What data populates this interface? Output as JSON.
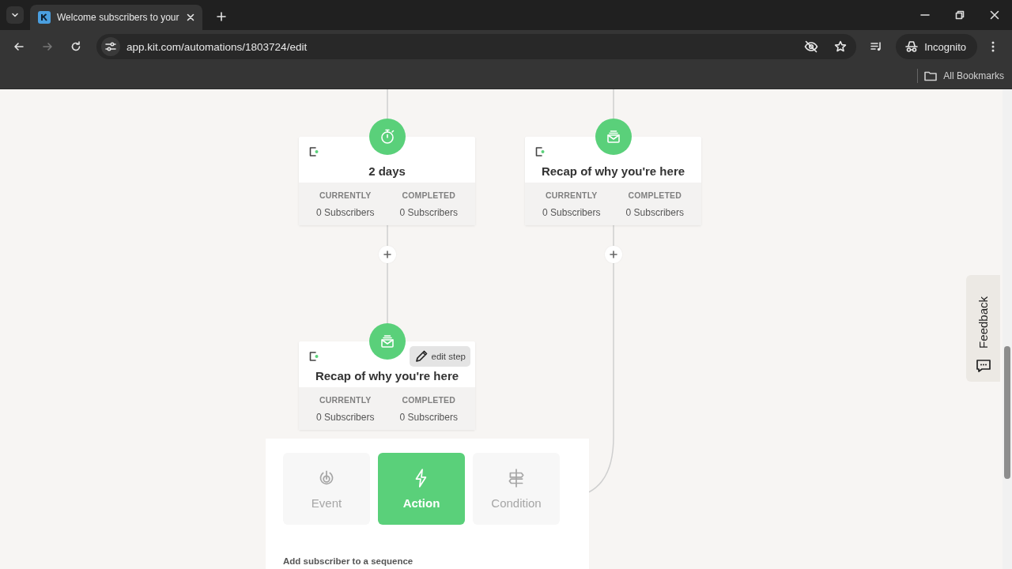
{
  "browser": {
    "tab_title": "Welcome subscribers to your",
    "url": "app.kit.com/automations/1803724/edit",
    "profile": "Incognito",
    "bookmarks": "All Bookmarks"
  },
  "nodes": [
    {
      "kind": "delay",
      "title": "2 days",
      "stats": [
        {
          "label": "CURRENTLY",
          "value": "0 Subscribers"
        },
        {
          "label": "COMPLETED",
          "value": "0 Subscribers"
        }
      ]
    },
    {
      "kind": "email",
      "title": "Recap of why you're here",
      "stats": [
        {
          "label": "CURRENTLY",
          "value": "0 Subscribers"
        },
        {
          "label": "COMPLETED",
          "value": "0 Subscribers"
        }
      ]
    },
    {
      "kind": "email",
      "title": "Recap of why you're here",
      "edit_label": "edit step",
      "stats": [
        {
          "label": "CURRENTLY",
          "value": "0 Subscribers"
        },
        {
          "label": "COMPLETED",
          "value": "0 Subscribers"
        }
      ]
    }
  ],
  "step_types": [
    {
      "kind": "event",
      "label": "Event",
      "selected": false
    },
    {
      "kind": "action",
      "label": "Action",
      "selected": true
    },
    {
      "kind": "condition",
      "label": "Condition",
      "selected": false
    }
  ],
  "step_section_title": "Add subscriber to a sequence",
  "feedback": "Feedback"
}
